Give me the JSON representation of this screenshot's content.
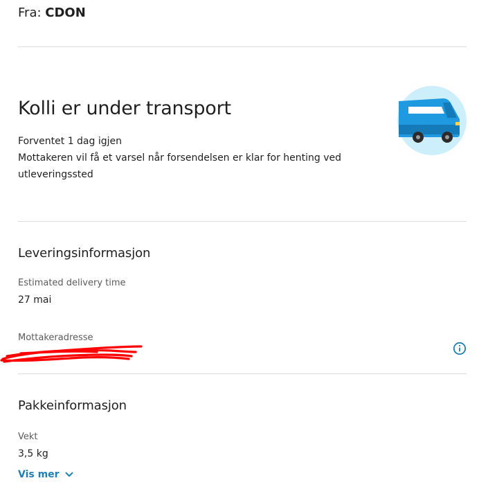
{
  "sender": {
    "prefix": "Fra:",
    "name": "CDON"
  },
  "status": {
    "title": "Kolli er under transport",
    "eta_text": "Forventet 1 dag igjen",
    "notice_line1": "Mottakeren vil få et varsel når forsendelsen er klar for henting ved",
    "notice_line2": "utleveringssted"
  },
  "illustration": {
    "icon": "delivery-van-icon",
    "circle_color": "#cdeefb",
    "van_color": "#1f9ae0",
    "van_dark_color": "#147bb8"
  },
  "delivery_info": {
    "title": "Leveringsinformasjon",
    "time_label": "Estimated delivery time",
    "time_value": "27 mai",
    "address_label": "Mottakeradresse",
    "address_redaction_color": "#ff0000",
    "info_icon": "info-circle-icon"
  },
  "package_info": {
    "title": "Pakkeinformasjon",
    "weight_label": "Vekt",
    "weight_value": "3,5 kg",
    "show_more_label": "Vis mer",
    "show_more_icon": "chevron-down-icon"
  },
  "colors": {
    "accent": "#1f7fb3",
    "divider": "#dddddd",
    "text": "#1f1f1f",
    "muted": "#5b5b5b"
  }
}
